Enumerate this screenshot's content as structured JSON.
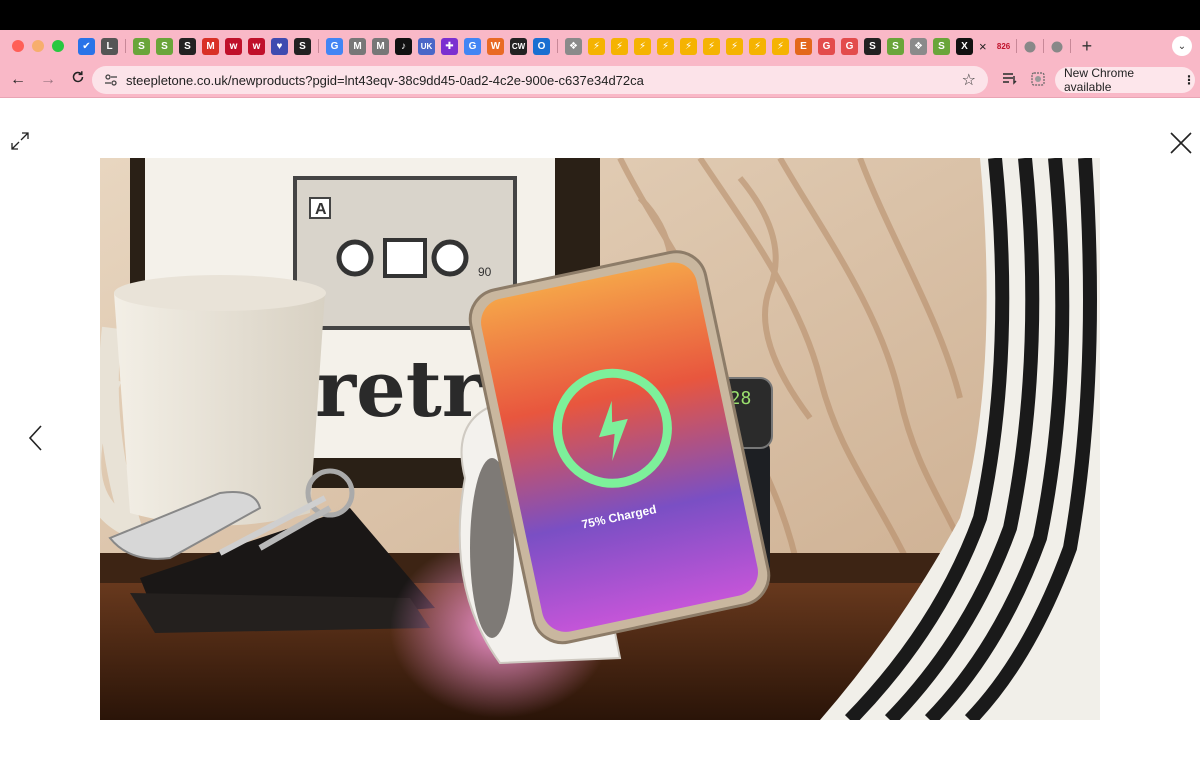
{
  "browser": {
    "tabs": [
      {
        "icon": "todo-icon",
        "glyph": "✔",
        "color": "#2a73e8"
      },
      {
        "icon": "letter-l-icon",
        "glyph": "L",
        "color": "#555555"
      },
      {
        "icon": "shopify-icon",
        "glyph": "S",
        "color": "#6aa53a"
      },
      {
        "icon": "shopify-icon",
        "glyph": "S",
        "color": "#6aa53a"
      },
      {
        "icon": "letter-s-icon",
        "glyph": "S",
        "color": "#222222"
      },
      {
        "icon": "gmail-icon",
        "glyph": "M",
        "color": "#d93025"
      },
      {
        "icon": "wp-icon",
        "glyph": "w",
        "color": "#c0102a"
      },
      {
        "icon": "wp-icon",
        "glyph": "w",
        "color": "#c0102a"
      },
      {
        "icon": "heart-icon",
        "glyph": "♥",
        "color": "#3f4bb0"
      },
      {
        "icon": "shopify-icon",
        "glyph": "S",
        "color": "#222222"
      },
      {
        "icon": "google-icon",
        "glyph": "G",
        "color": "#4285f4"
      },
      {
        "icon": "gmail-icon",
        "glyph": "M",
        "color": "#777777"
      },
      {
        "icon": "gmail-icon",
        "glyph": "M",
        "color": "#777777"
      },
      {
        "icon": "tiktok-icon",
        "glyph": "♪",
        "color": "#111111"
      },
      {
        "icon": "uk-icon",
        "glyph": "UK",
        "color": "#4a66c8"
      },
      {
        "icon": "target-icon",
        "glyph": "✚",
        "color": "#7b2fd0"
      },
      {
        "icon": "google-icon",
        "glyph": "G",
        "color": "#4285f4"
      },
      {
        "icon": "letter-w-icon",
        "glyph": "W",
        "color": "#e96a24"
      },
      {
        "icon": "cw-icon",
        "glyph": "CW",
        "color": "#222222"
      },
      {
        "icon": "outlook-icon",
        "glyph": "O",
        "color": "#1a6fd1"
      },
      {
        "icon": "stamp-icon",
        "glyph": "❖",
        "color": "#8a8a8a"
      },
      {
        "icon": "zap-icon",
        "glyph": "⚡",
        "color": "#f5b301"
      },
      {
        "icon": "zap-icon",
        "glyph": "⚡",
        "color": "#f5b301"
      },
      {
        "icon": "zap-icon",
        "glyph": "⚡",
        "color": "#f5b301"
      },
      {
        "icon": "zap-icon",
        "glyph": "⚡",
        "color": "#f5b301"
      },
      {
        "icon": "zap-icon",
        "glyph": "⚡",
        "color": "#f5b301"
      },
      {
        "icon": "zap-icon",
        "glyph": "⚡",
        "color": "#f5b301"
      },
      {
        "icon": "zap-icon",
        "glyph": "⚡",
        "color": "#f5b301"
      },
      {
        "icon": "zap-icon",
        "glyph": "⚡",
        "color": "#f5b301"
      },
      {
        "icon": "zap-icon",
        "glyph": "⚡",
        "color": "#f5b301"
      },
      {
        "icon": "etsy-icon",
        "glyph": "E",
        "color": "#e3681b"
      },
      {
        "icon": "grammarly-icon",
        "glyph": "G",
        "color": "#e34c4c"
      },
      {
        "icon": "grammarly-icon",
        "glyph": "G",
        "color": "#e34c4c"
      },
      {
        "icon": "shopify-icon",
        "glyph": "S",
        "color": "#222222"
      },
      {
        "icon": "shopify-icon",
        "glyph": "S",
        "color": "#6aa53a"
      },
      {
        "icon": "stamp-icon",
        "glyph": "❖",
        "color": "#8a8a8a"
      },
      {
        "icon": "shopify-icon",
        "glyph": "S",
        "color": "#6aa53a"
      },
      {
        "icon": "x-icon",
        "glyph": "X",
        "color": "#111111"
      }
    ],
    "active_tab_close": "×",
    "badge_text": "826",
    "apple_tabs": [
      "",
      ""
    ],
    "new_tab": "+",
    "tab_menu": "⌄",
    "back": "←",
    "forward": "→",
    "reload": "C",
    "url": "steepletone.co.uk/newproducts?pgid=lnt43eqv-38c9dd45-0ad2-4c2e-900e-c637e34d72ca",
    "star": "☆",
    "update_label": "New Chrome available",
    "update_menu": "⋮"
  },
  "viewer": {
    "phone_status": "75% Charged",
    "poster_letter": "A",
    "poster_word": "retr",
    "poster_number": "90",
    "watch_time": "1:28"
  },
  "colors": {
    "tabstrip": "#f9b8c7",
    "omnibox": "#fce3e9"
  }
}
